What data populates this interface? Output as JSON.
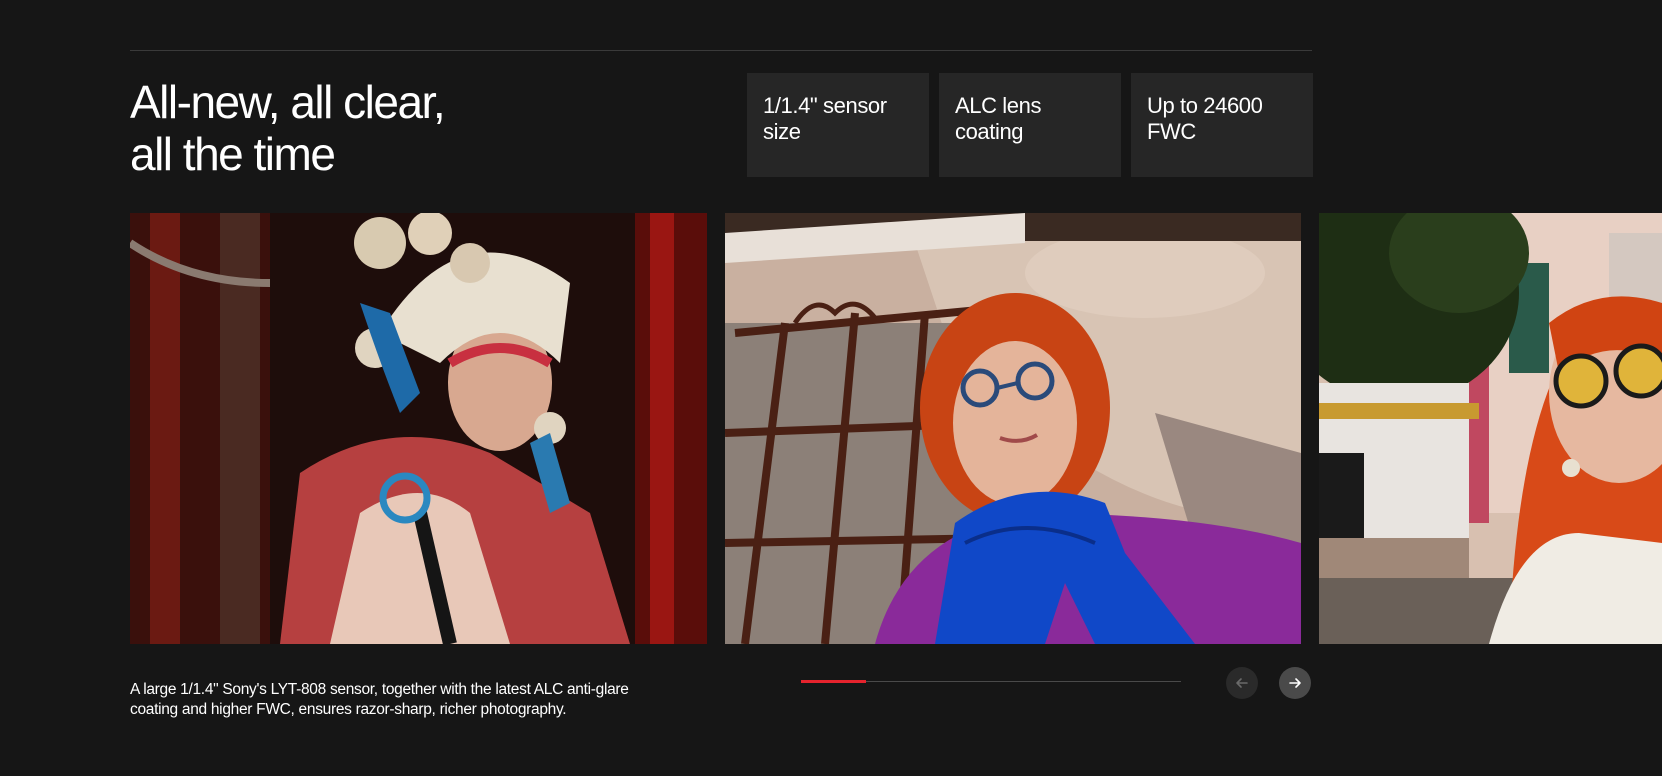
{
  "section": {
    "title_lines": [
      "All-new, all clear,",
      "all the time"
    ],
    "specs": [
      {
        "label": "1/1.4\" sensor size"
      },
      {
        "label": "ALC lens coating"
      },
      {
        "label": "Up to 24600 FWC"
      }
    ],
    "caption": "A large 1/1.4\" Sony's LYT-808 sensor, together with the latest ALC anti-glare coating and higher FWC, ensures razor-sharp, richer photography."
  },
  "carousel": {
    "progress_fraction": 0.17,
    "accent_color": "#e5232d",
    "prev_icon": "arrow-left-icon",
    "next_icon": "arrow-right-icon"
  },
  "colors": {
    "background": "#161616",
    "spec_card": "#262626"
  }
}
